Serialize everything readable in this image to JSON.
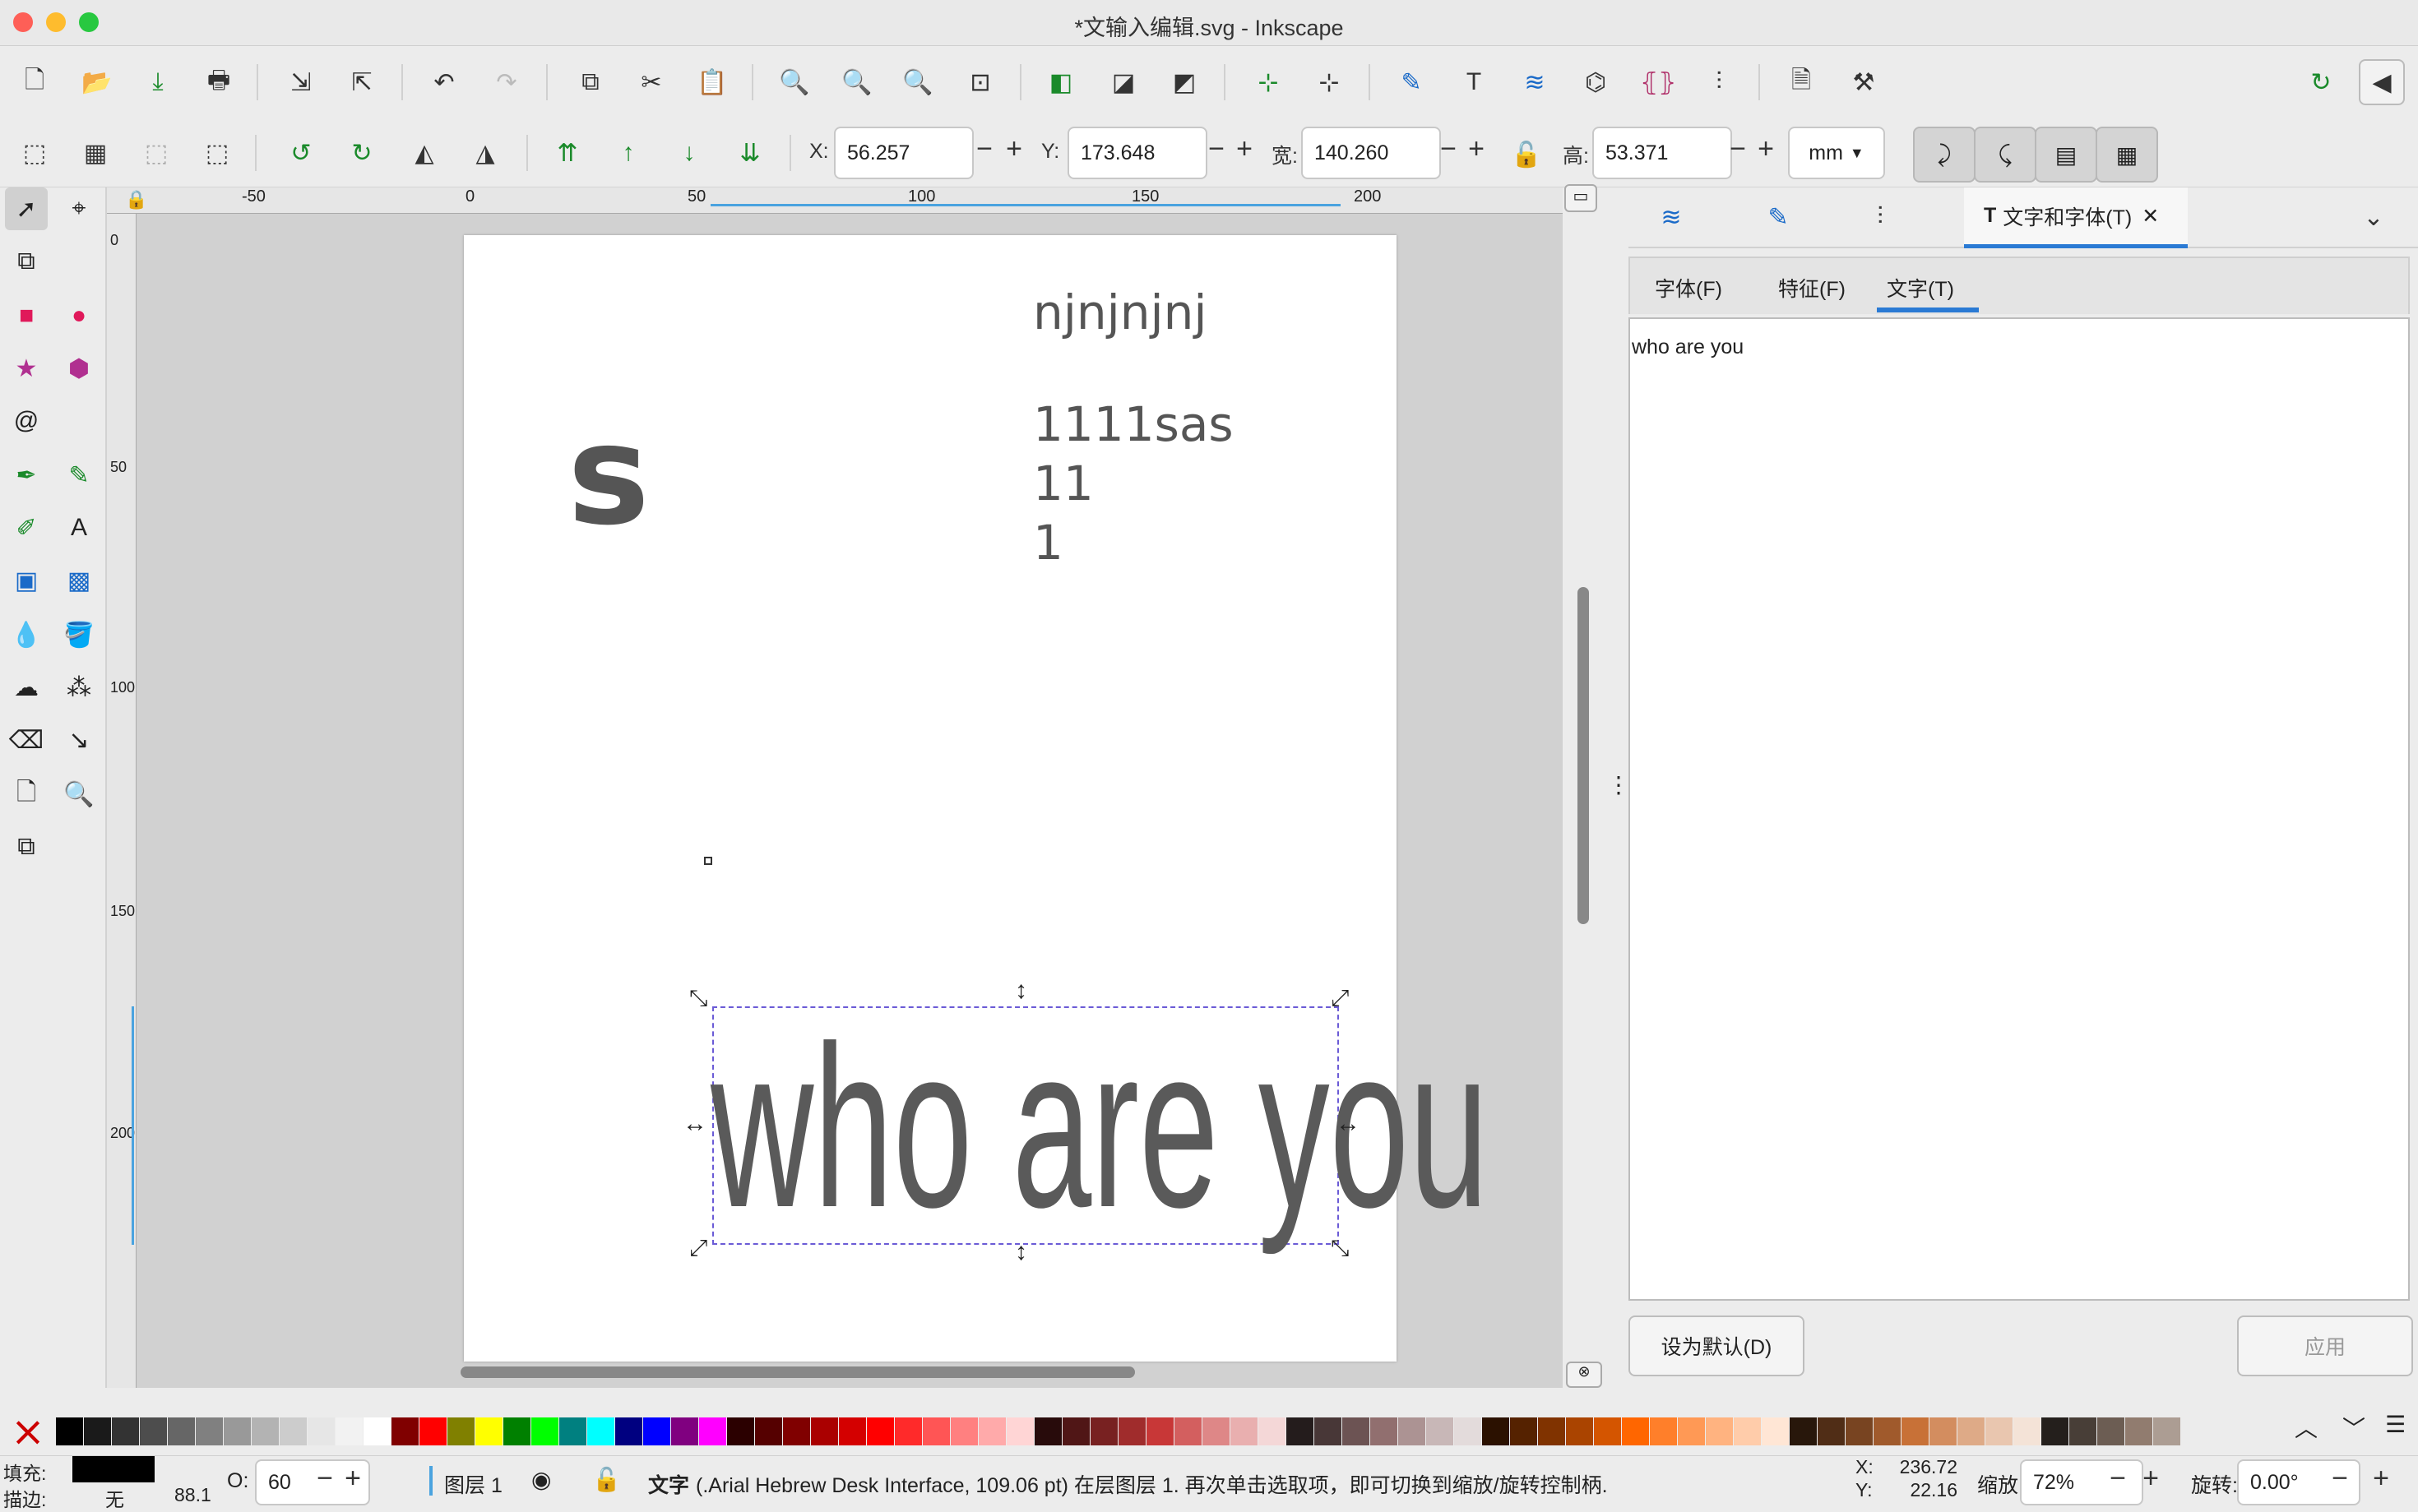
{
  "window": {
    "title": "*文输入编辑.svg - Inkscape"
  },
  "controls": {
    "x_label": "X:",
    "x_value": "56.257",
    "y_label": "Y:",
    "y_value": "173.648",
    "w_label": "宽:",
    "w_value": "140.260",
    "h_label": "高:",
    "h_value": "53.371",
    "unit": "mm"
  },
  "ruler": {
    "top_ticks": [
      "-50",
      "0",
      "50",
      "100",
      "150",
      "200"
    ],
    "left_ticks": [
      "0",
      "50",
      "100",
      "150",
      "200"
    ]
  },
  "canvas": {
    "text_s": "s",
    "text_njn": "njnjnjnj",
    "text_line1": "1111sas",
    "text_line2": "11",
    "text_line3": "1",
    "text_selected": "who are you"
  },
  "dock": {
    "tab_title": "文字和字体(T)",
    "subtabs": [
      "字体(F)",
      "特征(F)",
      "文字(T)"
    ],
    "editor_text": "who are you",
    "set_default": "设为默认(D)",
    "apply": "应用"
  },
  "palette": {
    "colors": [
      "#000000",
      "#1a1a1a",
      "#333333",
      "#4d4d4d",
      "#666666",
      "#808080",
      "#999999",
      "#b3b3b3",
      "#cccccc",
      "#e6e6e6",
      "#f2f2f2",
      "#ffffff",
      "#800000",
      "#ff0000",
      "#808000",
      "#ffff00",
      "#008000",
      "#00ff00",
      "#008080",
      "#00ffff",
      "#000080",
      "#0000ff",
      "#800080",
      "#ff00ff",
      "#2b0000",
      "#550000",
      "#800000",
      "#aa0000",
      "#d40000",
      "#ff0000",
      "#ff2a2a",
      "#ff5555",
      "#ff8080",
      "#ffaaaa",
      "#ffd5d5",
      "#280b0b",
      "#501616",
      "#782121",
      "#a02c2c",
      "#c83737",
      "#d35f5f",
      "#de8787",
      "#e9afaf",
      "#f4d7d7",
      "#241c1c",
      "#483737",
      "#6c5353",
      "#916f6f",
      "#ac9393",
      "#c8b7b7",
      "#e3dbdb",
      "#2b1100",
      "#552200",
      "#803300",
      "#aa4400",
      "#d45500",
      "#ff6600",
      "#ff7f2a",
      "#ff9955",
      "#ffb380",
      "#ffccaa",
      "#ffe6d5",
      "#28170b",
      "#502d16",
      "#784421",
      "#a05a2c",
      "#c87137",
      "#d38d5f",
      "#deaa87",
      "#e9c6af",
      "#f4e3d7",
      "#241f1c",
      "#483e37",
      "#6c5d53",
      "#917c6f",
      "#ac9d93"
    ]
  },
  "status": {
    "fill_label": "填充:",
    "stroke_label": "描边:",
    "stroke_value": "无",
    "stroke_width": "88.1",
    "opacity_label": "O:",
    "opacity_value": "60",
    "layer": "图层 1",
    "message_bold": "文字",
    "message": "(.Arial Hebrew Desk Interface, 109.06 pt) 在层图层 1. 再次单击选取项，即可切换到缩放/旋转控制柄.",
    "cursor_x": "236.72",
    "cursor_y": "22.16",
    "zoom_label": "缩放:",
    "zoom": "72%",
    "rotate_label": "旋转:",
    "rotate": "0.00°"
  }
}
